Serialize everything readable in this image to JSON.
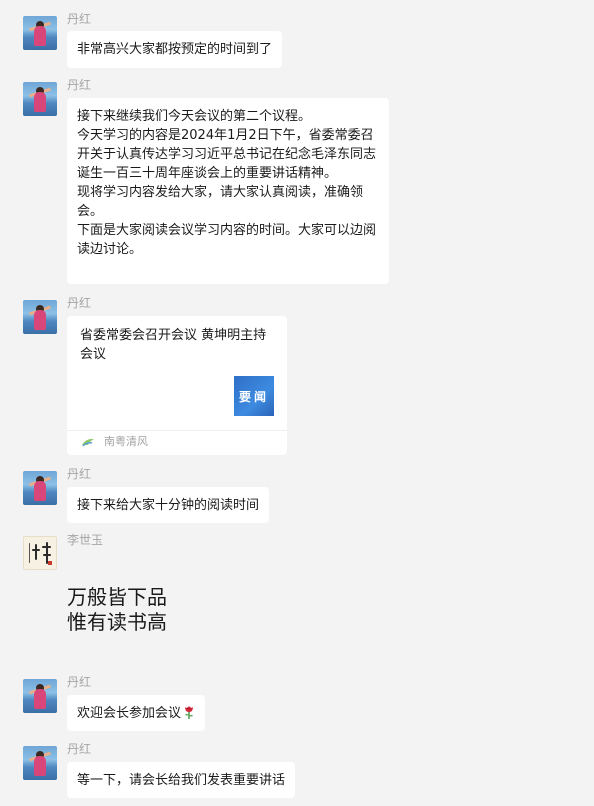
{
  "chat": {
    "messages": [
      {
        "sender": "丹红",
        "text": "非常高兴大家都按预定的时间到了"
      },
      {
        "sender": "丹红",
        "lines": [
          "接下来继续我们今天会议的第二个议程。",
          "今天学习的内容是2024年1月2日下午，省委常委召开关于认真传达学习习近平总书记在纪念毛泽东同志诞生一百三十周年座谈会上的重要讲话精神。",
          "现将学习内容发给大家，请大家认真阅读，准确领会。",
          "下面是大家阅读会议学习内容的时间。大家可以边阅读边讨论。"
        ]
      },
      {
        "sender": "丹红",
        "card": {
          "title": "省委常委会召开会议 黄坤明主持会议",
          "thumb_text": "要闻",
          "source": "南粤清风"
        }
      },
      {
        "sender": "丹红",
        "text": "接下来给大家十分钟的阅读时间"
      },
      {
        "sender": "李世玉",
        "lines": [
          "万般皆下品",
          "惟有读书高"
        ]
      },
      {
        "sender": "丹红",
        "text": "欢迎会长参加会议",
        "emoji": "rose-icon"
      },
      {
        "sender": "丹红",
        "text": "等一下，请会长给我们发表重要讲话"
      }
    ]
  },
  "colors": {
    "background": "#f3f3f3",
    "bubble": "#ffffff",
    "sender_name": "#a5a5a5",
    "thumb_blue": "#3d8be0"
  }
}
